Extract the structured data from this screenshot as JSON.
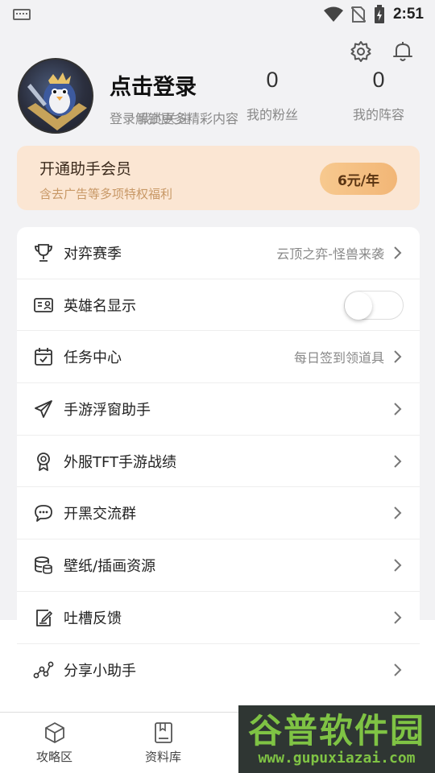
{
  "status_bar": {
    "time": "2:51"
  },
  "profile": {
    "title": "点击登录",
    "subtitle": "登录解锁更多精彩内容",
    "overlay_text": "我的关注",
    "stats": [
      {
        "value": "0",
        "label": "我的粉丝"
      },
      {
        "value": "0",
        "label": "我的阵容"
      }
    ]
  },
  "vip": {
    "title": "开通助手会员",
    "subtitle": "含去广告等多项特权福利",
    "price": "6元/年"
  },
  "menu": {
    "items": [
      {
        "label": "对弈赛季",
        "value": "云顶之弈-怪兽来袭",
        "icon": "trophy-icon"
      },
      {
        "label": "英雄名显示",
        "toggle": false,
        "icon": "id-card-icon"
      },
      {
        "label": "任务中心",
        "value": "每日签到领道具",
        "icon": "calendar-check-icon"
      },
      {
        "label": "手游浮窗助手",
        "icon": "paper-plane-icon"
      },
      {
        "label": "外服TFT手游战绩",
        "icon": "medal-icon"
      },
      {
        "label": "开黑交流群",
        "icon": "chat-icon"
      },
      {
        "label": "壁纸/插画资源",
        "icon": "database-icon"
      },
      {
        "label": "吐槽反馈",
        "icon": "edit-icon"
      },
      {
        "label": "分享小助手",
        "icon": "share-icon"
      }
    ]
  },
  "tabs": [
    {
      "label": "攻略区",
      "icon": "cube-icon"
    },
    {
      "label": "资料库",
      "icon": "book-icon"
    }
  ],
  "watermark": {
    "title": "谷普软件园",
    "url": "www.gupuxiazai.com"
  }
}
